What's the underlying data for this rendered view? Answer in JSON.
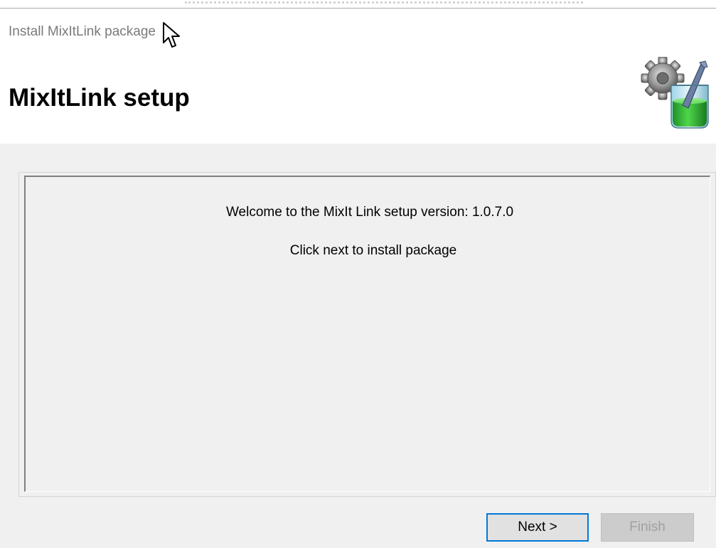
{
  "window": {
    "title": "Install MixItLink package"
  },
  "header": {
    "title": "MixItLink setup",
    "icon": "setup-gear-beaker-icon"
  },
  "content": {
    "welcome_text": "Welcome to the MixIt Link setup version: 1.0.7.0",
    "instruction_text": "Click next to install package"
  },
  "buttons": {
    "next_label": "Next >",
    "finish_label": "Finish"
  },
  "colors": {
    "focus_border": "#0078d7",
    "panel_background": "#f0f0f0",
    "disabled_text": "#a0a0a0"
  }
}
